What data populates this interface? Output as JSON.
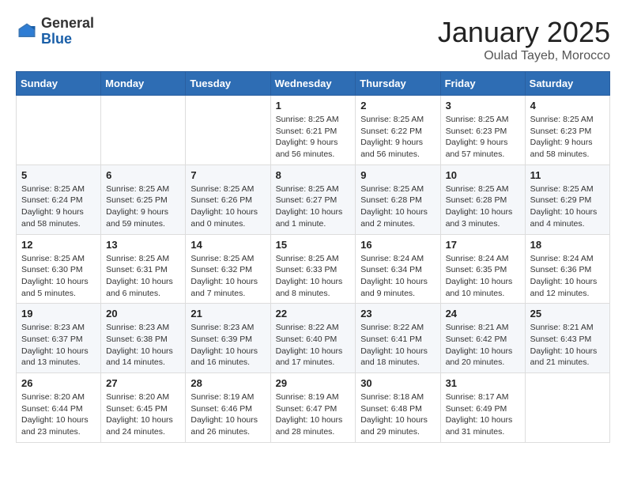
{
  "header": {
    "logo_general": "General",
    "logo_blue": "Blue",
    "month_title": "January 2025",
    "location": "Oulad Tayeb, Morocco"
  },
  "days_of_week": [
    "Sunday",
    "Monday",
    "Tuesday",
    "Wednesday",
    "Thursday",
    "Friday",
    "Saturday"
  ],
  "weeks": [
    [
      {
        "day": "",
        "info": ""
      },
      {
        "day": "",
        "info": ""
      },
      {
        "day": "",
        "info": ""
      },
      {
        "day": "1",
        "info": "Sunrise: 8:25 AM\nSunset: 6:21 PM\nDaylight: 9 hours and 56 minutes."
      },
      {
        "day": "2",
        "info": "Sunrise: 8:25 AM\nSunset: 6:22 PM\nDaylight: 9 hours and 56 minutes."
      },
      {
        "day": "3",
        "info": "Sunrise: 8:25 AM\nSunset: 6:23 PM\nDaylight: 9 hours and 57 minutes."
      },
      {
        "day": "4",
        "info": "Sunrise: 8:25 AM\nSunset: 6:23 PM\nDaylight: 9 hours and 58 minutes."
      }
    ],
    [
      {
        "day": "5",
        "info": "Sunrise: 8:25 AM\nSunset: 6:24 PM\nDaylight: 9 hours and 58 minutes."
      },
      {
        "day": "6",
        "info": "Sunrise: 8:25 AM\nSunset: 6:25 PM\nDaylight: 9 hours and 59 minutes."
      },
      {
        "day": "7",
        "info": "Sunrise: 8:25 AM\nSunset: 6:26 PM\nDaylight: 10 hours and 0 minutes."
      },
      {
        "day": "8",
        "info": "Sunrise: 8:25 AM\nSunset: 6:27 PM\nDaylight: 10 hours and 1 minute."
      },
      {
        "day": "9",
        "info": "Sunrise: 8:25 AM\nSunset: 6:28 PM\nDaylight: 10 hours and 2 minutes."
      },
      {
        "day": "10",
        "info": "Sunrise: 8:25 AM\nSunset: 6:28 PM\nDaylight: 10 hours and 3 minutes."
      },
      {
        "day": "11",
        "info": "Sunrise: 8:25 AM\nSunset: 6:29 PM\nDaylight: 10 hours and 4 minutes."
      }
    ],
    [
      {
        "day": "12",
        "info": "Sunrise: 8:25 AM\nSunset: 6:30 PM\nDaylight: 10 hours and 5 minutes."
      },
      {
        "day": "13",
        "info": "Sunrise: 8:25 AM\nSunset: 6:31 PM\nDaylight: 10 hours and 6 minutes."
      },
      {
        "day": "14",
        "info": "Sunrise: 8:25 AM\nSunset: 6:32 PM\nDaylight: 10 hours and 7 minutes."
      },
      {
        "day": "15",
        "info": "Sunrise: 8:25 AM\nSunset: 6:33 PM\nDaylight: 10 hours and 8 minutes."
      },
      {
        "day": "16",
        "info": "Sunrise: 8:24 AM\nSunset: 6:34 PM\nDaylight: 10 hours and 9 minutes."
      },
      {
        "day": "17",
        "info": "Sunrise: 8:24 AM\nSunset: 6:35 PM\nDaylight: 10 hours and 10 minutes."
      },
      {
        "day": "18",
        "info": "Sunrise: 8:24 AM\nSunset: 6:36 PM\nDaylight: 10 hours and 12 minutes."
      }
    ],
    [
      {
        "day": "19",
        "info": "Sunrise: 8:23 AM\nSunset: 6:37 PM\nDaylight: 10 hours and 13 minutes."
      },
      {
        "day": "20",
        "info": "Sunrise: 8:23 AM\nSunset: 6:38 PM\nDaylight: 10 hours and 14 minutes."
      },
      {
        "day": "21",
        "info": "Sunrise: 8:23 AM\nSunset: 6:39 PM\nDaylight: 10 hours and 16 minutes."
      },
      {
        "day": "22",
        "info": "Sunrise: 8:22 AM\nSunset: 6:40 PM\nDaylight: 10 hours and 17 minutes."
      },
      {
        "day": "23",
        "info": "Sunrise: 8:22 AM\nSunset: 6:41 PM\nDaylight: 10 hours and 18 minutes."
      },
      {
        "day": "24",
        "info": "Sunrise: 8:21 AM\nSunset: 6:42 PM\nDaylight: 10 hours and 20 minutes."
      },
      {
        "day": "25",
        "info": "Sunrise: 8:21 AM\nSunset: 6:43 PM\nDaylight: 10 hours and 21 minutes."
      }
    ],
    [
      {
        "day": "26",
        "info": "Sunrise: 8:20 AM\nSunset: 6:44 PM\nDaylight: 10 hours and 23 minutes."
      },
      {
        "day": "27",
        "info": "Sunrise: 8:20 AM\nSunset: 6:45 PM\nDaylight: 10 hours and 24 minutes."
      },
      {
        "day": "28",
        "info": "Sunrise: 8:19 AM\nSunset: 6:46 PM\nDaylight: 10 hours and 26 minutes."
      },
      {
        "day": "29",
        "info": "Sunrise: 8:19 AM\nSunset: 6:47 PM\nDaylight: 10 hours and 28 minutes."
      },
      {
        "day": "30",
        "info": "Sunrise: 8:18 AM\nSunset: 6:48 PM\nDaylight: 10 hours and 29 minutes."
      },
      {
        "day": "31",
        "info": "Sunrise: 8:17 AM\nSunset: 6:49 PM\nDaylight: 10 hours and 31 minutes."
      },
      {
        "day": "",
        "info": ""
      }
    ]
  ]
}
